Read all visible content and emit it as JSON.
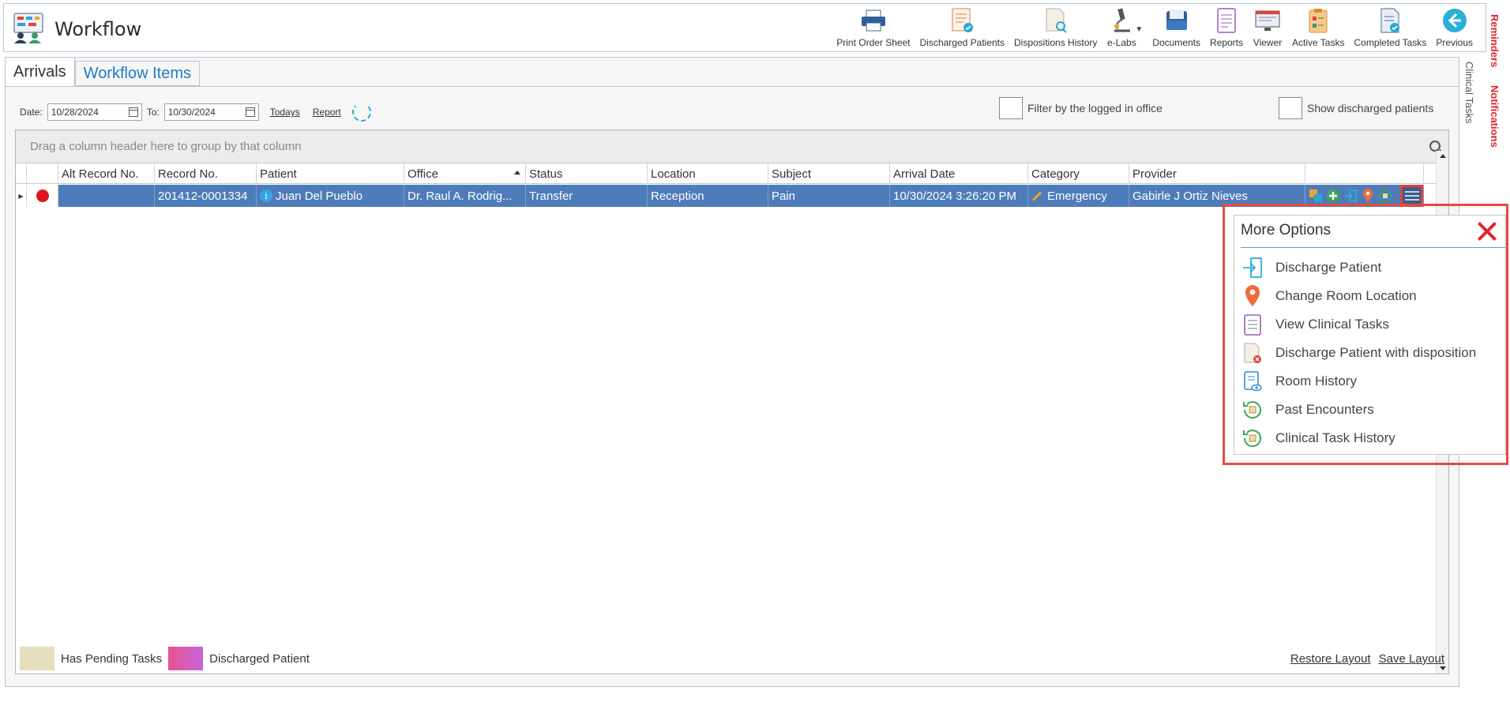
{
  "app": {
    "title": "Workflow"
  },
  "toolbar": [
    {
      "label": "Print Order Sheet",
      "icon": "printer-icon"
    },
    {
      "label": "Discharged Patients",
      "icon": "discharged-patients-icon"
    },
    {
      "label": "Dispositions History",
      "icon": "dispositions-history-icon"
    },
    {
      "label": "e-Labs",
      "icon": "microscope-icon"
    },
    {
      "label": "Documents",
      "icon": "documents-icon"
    },
    {
      "label": "Reports",
      "icon": "reports-icon"
    },
    {
      "label": "Viewer",
      "icon": "viewer-icon"
    },
    {
      "label": "Active Tasks",
      "icon": "active-tasks-icon"
    },
    {
      "label": "Completed Tasks",
      "icon": "completed-tasks-icon"
    },
    {
      "label": "Previous",
      "icon": "arrow-left-icon"
    }
  ],
  "side_tabs": {
    "reminders": "Reminders",
    "notifications": "Notifications",
    "clinical_tasks": "Clinical Tasks"
  },
  "tabs": {
    "arrivals": "Arrivals",
    "workflow_items": "Workflow Items"
  },
  "filters": {
    "date_label": "Date:",
    "date_from": "10/28/2024",
    "to_label": "To:",
    "date_to": "10/30/2024",
    "todays": "Todays",
    "report": "Report",
    "filter_office": "Filter by the logged in office",
    "show_discharged": "Show discharged patients"
  },
  "grid": {
    "group_hint": "Drag a column header here to group by that column",
    "columns": [
      "Alt Record No.",
      "Record No.",
      "Patient",
      "Office",
      "Status",
      "Location",
      "Subject",
      "Arrival Date",
      "Category",
      "Provider"
    ],
    "rows": [
      {
        "alt_record": "",
        "record": "201412-0001334",
        "patient": "Juan Del Pueblo",
        "office": "Dr. Raul A. Rodrig...",
        "status": "Transfer",
        "location": "Reception",
        "subject": "Pain",
        "arrival_date": "10/30/2024 3:26:20 PM",
        "category": "Emergency",
        "provider": "Gabirle J Ortiz Nieves"
      }
    ]
  },
  "legend": {
    "pending": "Has Pending Tasks",
    "discharged": "Discharged Patient"
  },
  "layout": {
    "restore": "Restore Layout",
    "save": "Save Layout"
  },
  "popup": {
    "title": "More Options",
    "items": [
      "Discharge Patient",
      "Change Room Location",
      "View Clinical Tasks",
      "Discharge Patient with disposition",
      "Room History",
      "Past Encounters",
      "Clinical Task History"
    ]
  },
  "colors": {
    "selected_row": "#4e7cba",
    "accent_red": "#e0242b",
    "link_blue": "#1e7bc4"
  }
}
